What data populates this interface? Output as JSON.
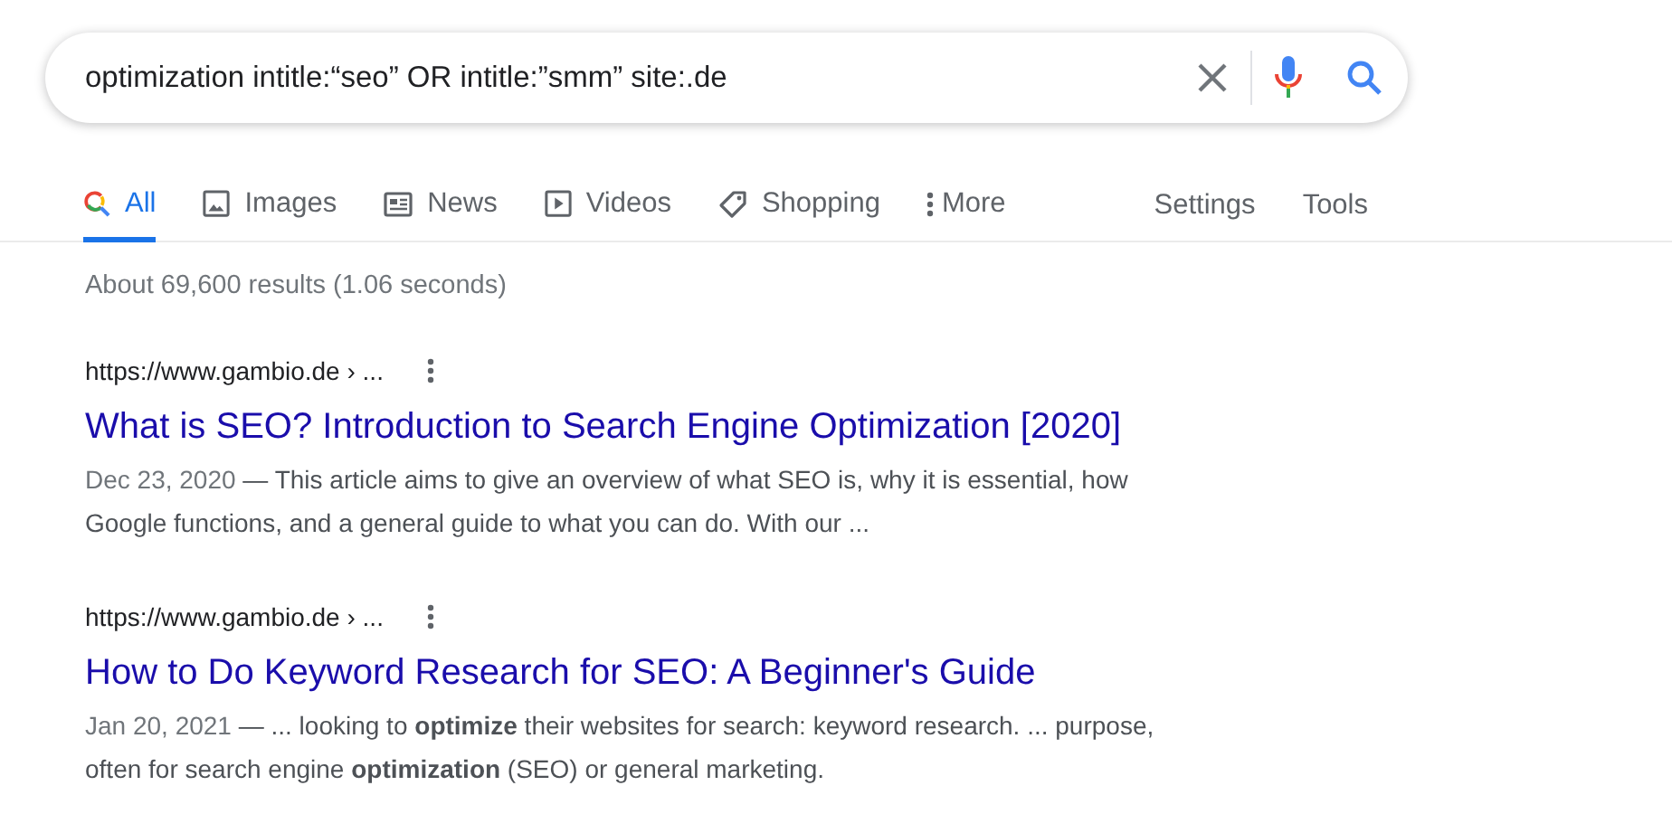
{
  "search": {
    "query": "optimization intitle:“seo” OR intitle:”smm” site:.de"
  },
  "tabs": [
    {
      "label": "All",
      "kind": "search",
      "selected": true
    },
    {
      "label": "Images",
      "kind": "image",
      "selected": false
    },
    {
      "label": "News",
      "kind": "news",
      "selected": false
    },
    {
      "label": "Videos",
      "kind": "video",
      "selected": false
    },
    {
      "label": "Shopping",
      "kind": "tag",
      "selected": false
    },
    {
      "label": "More",
      "kind": "more",
      "selected": false
    }
  ],
  "tools": [
    "Settings",
    "Tools"
  ],
  "stats": "About 69,600 results (1.06 seconds)",
  "results": [
    {
      "url": "https://www.gambio.de › ...",
      "title": "What is SEO? Introduction to Search Engine Optimization [2020]",
      "date": "Dec 23, 2020",
      "snippet": " — This article aims to give an overview of what SEO is, why it is essential, how Google functions, and a general guide to what you can do. With our ..."
    },
    {
      "url": "https://www.gambio.de › ...",
      "title": "How to Do Keyword Research for SEO: A Beginner's Guide",
      "date": "Jan 20, 2021",
      "snippet": " — ... looking to **optimize** their websites for search: keyword research. ... purpose, often for search engine **optimization** (SEO) or general marketing."
    }
  ]
}
